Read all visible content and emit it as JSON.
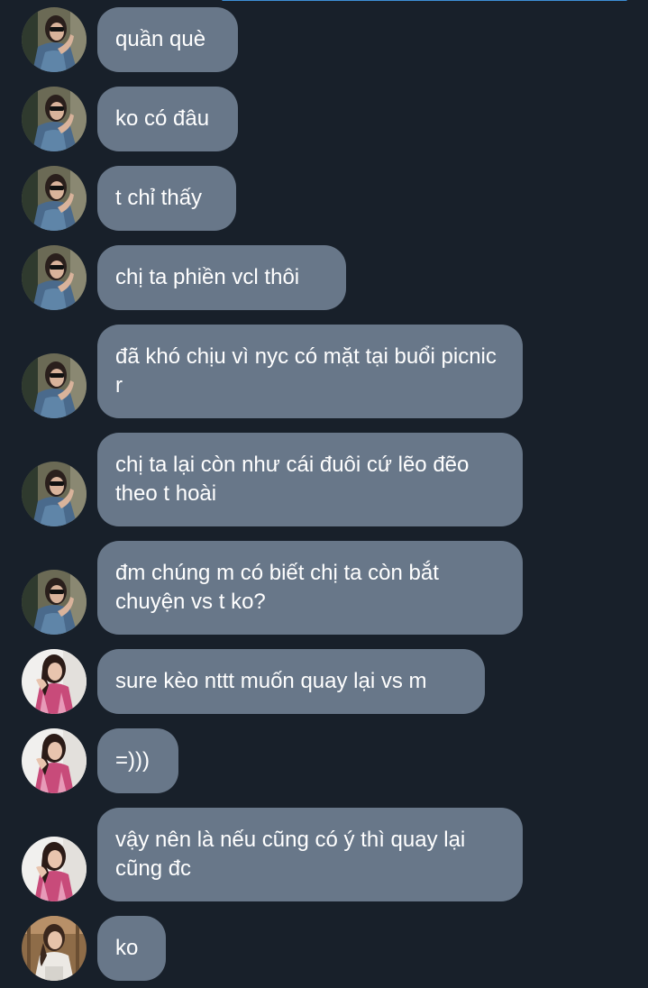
{
  "colors": {
    "background": "#18202a",
    "bubble": "#687789",
    "text": "#ffffff",
    "accent": "#3d8fd6"
  },
  "messages": [
    {
      "sender": "user-a",
      "text": "quần què"
    },
    {
      "sender": "user-a",
      "text": "ko có đâu"
    },
    {
      "sender": "user-a",
      "text": "t chỉ thấy"
    },
    {
      "sender": "user-a",
      "text": "chị ta phiền vcl thôi"
    },
    {
      "sender": "user-a",
      "text": "đã khó chịu vì nyc có mặt tại buổi picnic r"
    },
    {
      "sender": "user-a",
      "text": "chị ta lại còn như cái đuôi cứ lẽo đẽo theo t hoài"
    },
    {
      "sender": "user-a",
      "text": "đm chúng m có biết chị ta còn bắt chuyện vs t ko?"
    },
    {
      "sender": "user-b",
      "text": "sure kèo nttt muốn quay lại vs m"
    },
    {
      "sender": "user-b",
      "text": "=)))"
    },
    {
      "sender": "user-b",
      "text": "vậy nên là nếu cũng có ý thì quay lại cũng đc"
    },
    {
      "sender": "user-c",
      "text": "ko"
    }
  ]
}
